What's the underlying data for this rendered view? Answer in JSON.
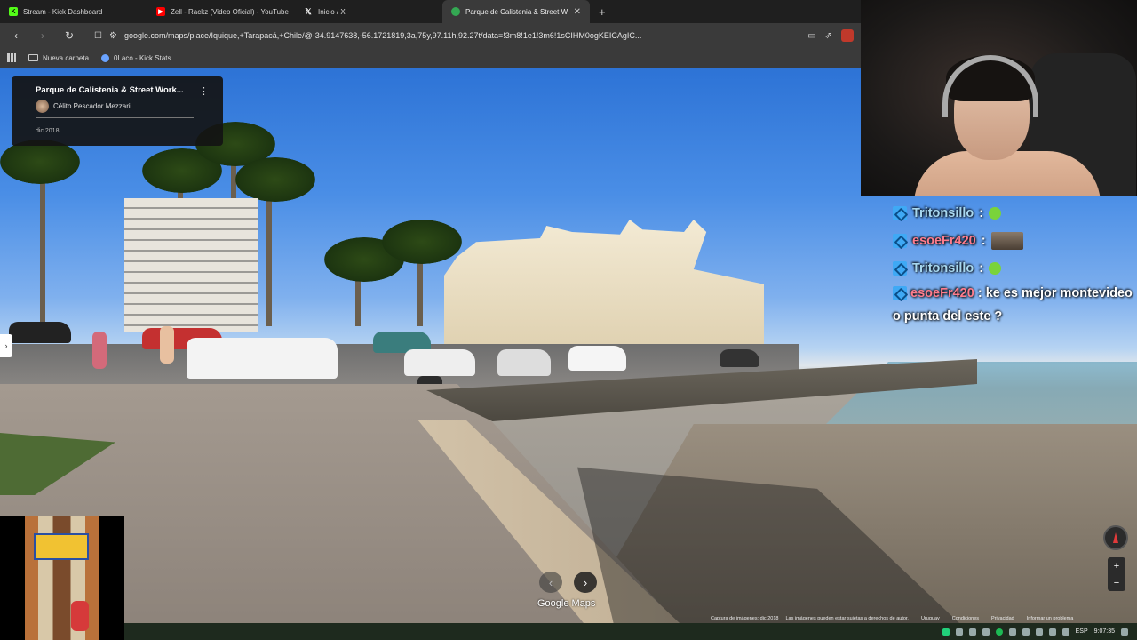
{
  "browser": {
    "tabs": [
      {
        "label": "Stream - Kick Dashboard",
        "favicon_color": "#53fc18",
        "active": false
      },
      {
        "label": "Zell - Rackz (Video Oficial) - YouTube",
        "favicon_color": "#ff0000",
        "active": false
      },
      {
        "label": "Inicio / X",
        "favicon_color": "#ffffff",
        "active": false
      },
      {
        "label": "Parque de Calistenia & Street W",
        "favicon_color": "#34a853",
        "active": true
      }
    ],
    "url": "google.com/maps/place/Iquique,+Tarapacá,+Chile/@-34.9147638,-56.1721819,3a,75y,97.11h,92.27t/data=!3m8!1e1!3m6!1sCIHM0ogKEICAgIC...",
    "bookmarks": [
      {
        "label": "Nueva carpeta",
        "icon": "folder-icon"
      },
      {
        "label": "0Laco - Kick Stats",
        "icon": "kick-icon"
      }
    ]
  },
  "maps": {
    "place_title": "Parque de Calistenia & Street Work...",
    "author": "Célito Pescador Mezzari",
    "date": "dic 2018",
    "brand": "Google Maps",
    "footer": {
      "capture": "Captura de imágenes: dic 2018",
      "rights": "Las imágenes pueden estar sujetas a derechos de autor.",
      "links": [
        "Uruguay",
        "Condiciones",
        "Privacidad",
        "Informar un problema"
      ]
    },
    "zoom_in": "+",
    "zoom_out": "−"
  },
  "chat": {
    "messages": [
      {
        "user": "Tritonsillo",
        "text": "",
        "emote": "green-emote",
        "user_color": "#a8d8f0"
      },
      {
        "user": "esoeFr420",
        "text": "",
        "emote": "image-emote",
        "user_color": "#ff7d8d"
      },
      {
        "user": "Tritonsillo",
        "text": "",
        "emote": "green-emote",
        "user_color": "#a8d8f0"
      },
      {
        "user": "esoeFr420",
        "text": "ke es mejor montevideo o punta del este ?",
        "emote": "",
        "user_color": "#ff7d8d"
      }
    ],
    "separator": ":"
  },
  "taskbar": {
    "language": "ESP",
    "time": "9:07:35"
  }
}
